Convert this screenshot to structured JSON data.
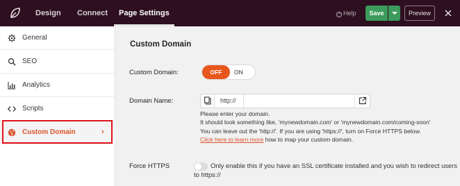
{
  "topbar": {
    "tabs": [
      {
        "label": "Design"
      },
      {
        "label": "Connect"
      },
      {
        "label": "Page Settings"
      }
    ],
    "help_label": "Help",
    "save_label": "Save",
    "preview_label": "Preview",
    "icons": {
      "logo": "seedprod-leaf-icon",
      "help": "question-circle-icon",
      "save_dropdown": "chevron-down-icon",
      "close": "close-icon"
    }
  },
  "sidebar": {
    "items": [
      {
        "label": "General",
        "icon": "gear-icon"
      },
      {
        "label": "SEO",
        "icon": "search-icon"
      },
      {
        "label": "Analytics",
        "icon": "bar-chart-icon"
      },
      {
        "label": "Scripts",
        "icon": "code-icon"
      },
      {
        "label": "Custom Domain",
        "icon": "globe-icon",
        "active": true
      }
    ],
    "active_chevron": "›"
  },
  "main": {
    "title": "Custom Domain",
    "custom_domain_label": "Custom Domain:",
    "toggle_off": "OFF",
    "toggle_on": "ON",
    "domain_name_label": "Domain Name:",
    "domain_prefix": "http://",
    "domain_value": "",
    "help_lines": [
      "Please enter your domain.",
      "It should look something like, 'mynewdomain.com' or 'mynewdomain.com/coming-soon'",
      "You can leave out the 'http://'. If you are using 'https://', turn on Force HTTPS below."
    ],
    "help_link": "Click here to learn more",
    "help_link_suffix": " how to map your custom domain.",
    "force_https_label": "Force HTTPS",
    "force_https_desc_1": "Only enable this if you have an SSL certificate installed and you wish to redirect users",
    "force_https_desc_2": "to https://"
  },
  "colors": {
    "topbar": "#2d0f1f",
    "accent": "#e8571d",
    "save": "#3c9a5c",
    "highlight": "#e0141b"
  }
}
